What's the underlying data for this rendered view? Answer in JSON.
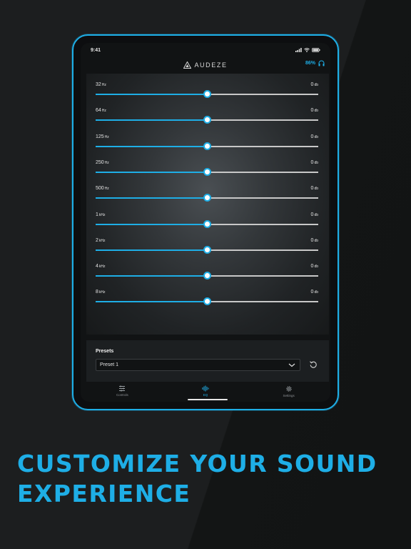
{
  "status": {
    "time": "9:41"
  },
  "app": {
    "brand": "AUDEZE",
    "battery": "86%"
  },
  "eq": {
    "bands": [
      {
        "freq": "32",
        "unit": "Hz",
        "value": "0",
        "value_unit": "db",
        "level": 0.5
      },
      {
        "freq": "64",
        "unit": "Hz",
        "value": "0",
        "value_unit": "db",
        "level": 0.5
      },
      {
        "freq": "125",
        "unit": "Hz",
        "value": "0",
        "value_unit": "db",
        "level": 0.5
      },
      {
        "freq": "250",
        "unit": "Hz",
        "value": "0",
        "value_unit": "db",
        "level": 0.5
      },
      {
        "freq": "500",
        "unit": "Hz",
        "value": "0",
        "value_unit": "db",
        "level": 0.5
      },
      {
        "freq": "1",
        "unit": "kHz",
        "value": "0",
        "value_unit": "db",
        "level": 0.5
      },
      {
        "freq": "2",
        "unit": "kHz",
        "value": "0",
        "value_unit": "db",
        "level": 0.5
      },
      {
        "freq": "4",
        "unit": "kHz",
        "value": "0",
        "value_unit": "db",
        "level": 0.5
      },
      {
        "freq": "8",
        "unit": "kHz",
        "value": "0",
        "value_unit": "db",
        "level": 0.5
      }
    ]
  },
  "presets": {
    "title": "Presets",
    "selected": "Preset 1"
  },
  "tabs": [
    {
      "label": "Controls",
      "icon": "sliders-icon",
      "active": false
    },
    {
      "label": "EQ",
      "icon": "waveform-icon",
      "active": true
    },
    {
      "label": "Settings",
      "icon": "gear-icon",
      "active": false
    }
  ],
  "headline": {
    "line1": "CUSTOMIZE YOUR SOUND",
    "line2": "EXPERIENCE"
  },
  "colors": {
    "accent": "#1eaee6",
    "background": "#1c1e1f"
  }
}
